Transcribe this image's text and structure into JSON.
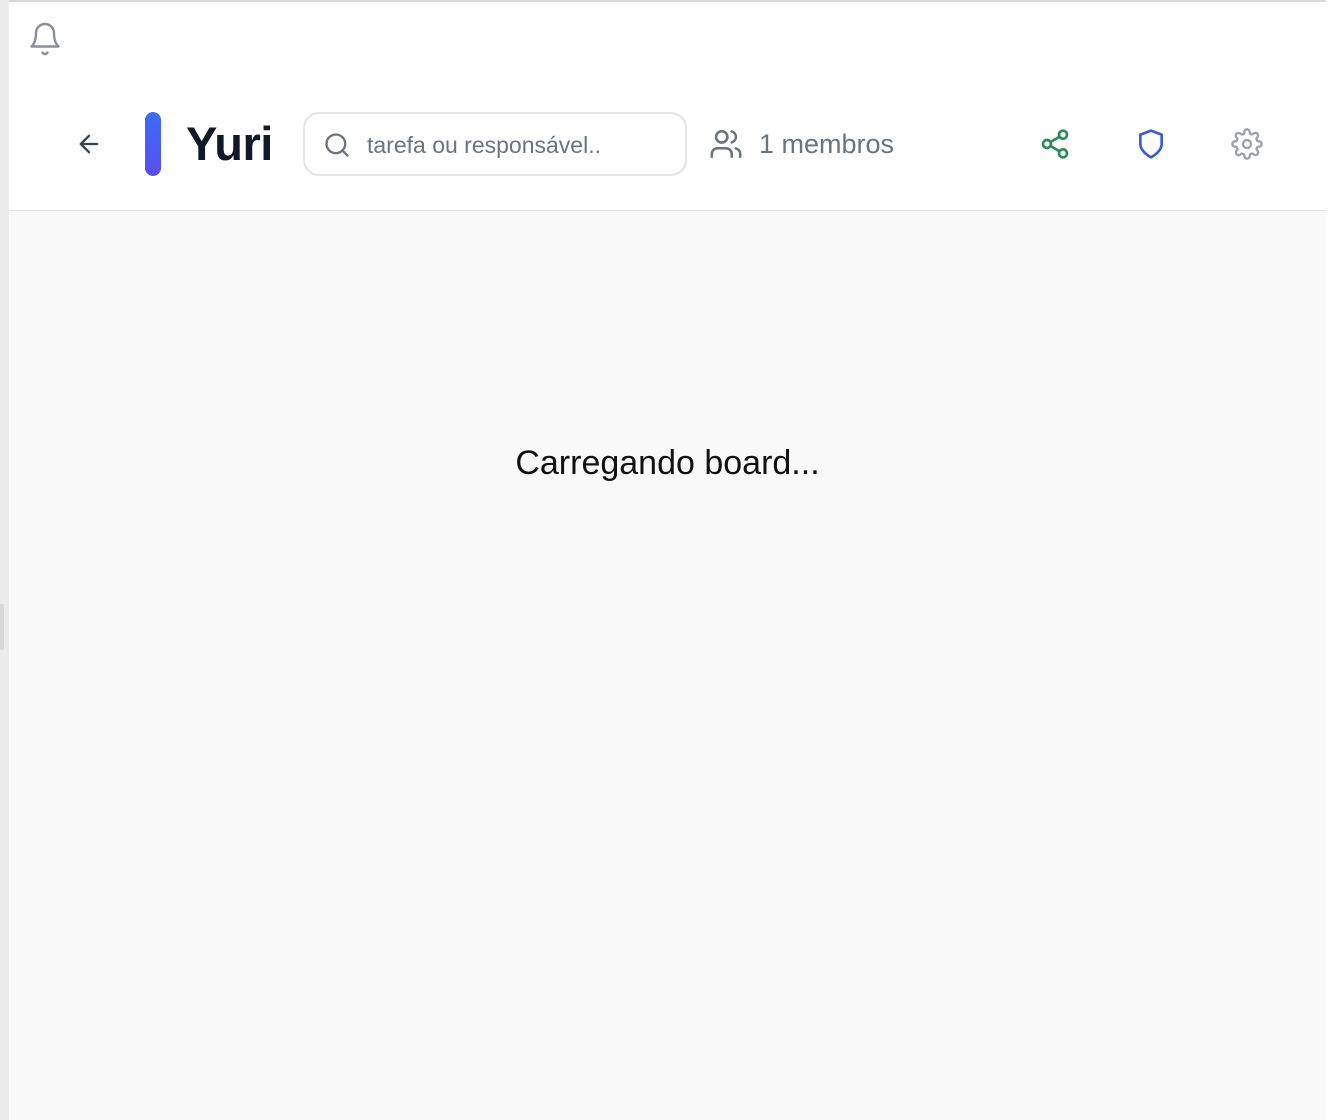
{
  "board": {
    "title": "Yuri"
  },
  "search": {
    "placeholder": "tarefa ou responsável.."
  },
  "members": {
    "label": "1 membros"
  },
  "content": {
    "loading_text": "Carregando board..."
  },
  "icons": {
    "bell": "bell-icon",
    "back": "arrow-left-icon",
    "search": "search-icon",
    "members": "users-icon",
    "share": "share-icon",
    "permissions": "shield-icon",
    "settings": "gear-icon"
  },
  "colors": {
    "accent_top": "#3b6cf5",
    "accent_bottom": "#5b4ef0",
    "share_icon": "#2e8b57",
    "shield_icon": "#3b5bdb",
    "gear_icon": "#9ca3af",
    "title_text": "#111827",
    "muted_text": "#6b7280"
  }
}
